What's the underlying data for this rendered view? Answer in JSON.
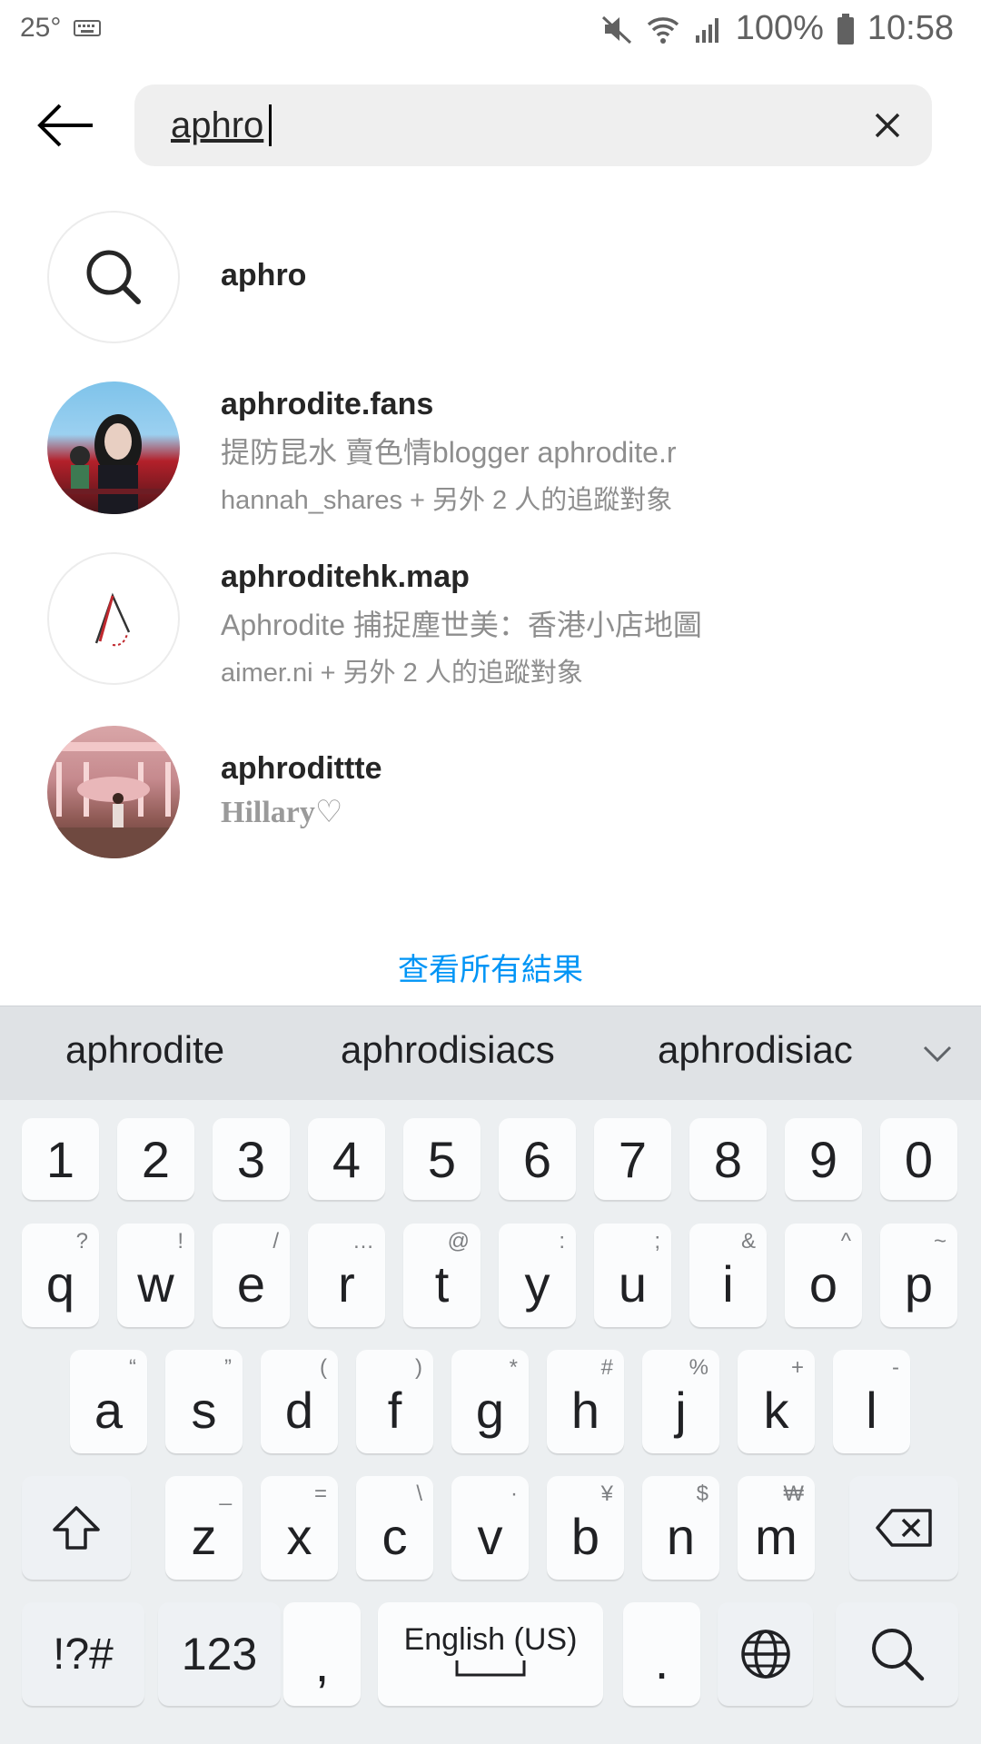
{
  "status_bar": {
    "temperature": "25°",
    "battery": "100%",
    "time": "10:58",
    "icons": [
      "keyboard-icon",
      "mute-icon",
      "wifi-icon",
      "signal-icon",
      "battery-icon"
    ]
  },
  "search": {
    "query": "aphro",
    "back_icon": "back-arrow-icon",
    "clear_icon": "close-icon"
  },
  "results": [
    {
      "type": "keyword",
      "title": "aphro",
      "icon": "search-icon"
    },
    {
      "type": "account",
      "username": "aphrodite.fans",
      "bio": "提防昆水 賣色情blogger aphrodite.r",
      "followed_by": "hannah_shares + 另外 2 人的追蹤對象"
    },
    {
      "type": "account",
      "username": "aphroditehk.map",
      "bio": "Aphrodite 捕捉塵世美：香港小店地圖",
      "followed_by": "aimer.ni + 另外 2 人的追蹤對象"
    },
    {
      "type": "account",
      "username": "aphrodittte",
      "bio": "Hillary♡"
    }
  ],
  "see_all": "查看所有結果",
  "keyboard": {
    "suggestions": [
      "aphrodite",
      "aphrodisiacs",
      "aphrodisiac"
    ],
    "numbers": [
      "1",
      "2",
      "3",
      "4",
      "5",
      "6",
      "7",
      "8",
      "9",
      "0"
    ],
    "row1": [
      [
        "q",
        "?"
      ],
      [
        "w",
        "!"
      ],
      [
        "e",
        "/"
      ],
      [
        "r",
        "…"
      ],
      [
        "t",
        "@"
      ],
      [
        "y",
        ":"
      ],
      [
        "u",
        ";"
      ],
      [
        "i",
        "&"
      ],
      [
        "o",
        "^"
      ],
      [
        "p",
        "~"
      ]
    ],
    "row2": [
      [
        "a",
        "“"
      ],
      [
        "s",
        "”"
      ],
      [
        "d",
        "("
      ],
      [
        "f",
        ")"
      ],
      [
        "g",
        "*"
      ],
      [
        "h",
        "#"
      ],
      [
        "j",
        "%"
      ],
      [
        "k",
        "+"
      ],
      [
        "l",
        "-"
      ]
    ],
    "row3": [
      [
        "z",
        "_"
      ],
      [
        "x",
        "="
      ],
      [
        "c",
        "\\"
      ],
      [
        "v",
        "·"
      ],
      [
        "b",
        "¥"
      ],
      [
        "n",
        "$"
      ],
      [
        "m",
        "₩"
      ]
    ],
    "sym_key": "!?#",
    "num_key": "123",
    "comma": ",",
    "space_label": "English (US)",
    "period": "."
  },
  "colors": {
    "link": "#0095f6",
    "secondary_text": "#8e8e8e",
    "search_bg": "#efefef",
    "keyboard_bg": "#eceff1"
  }
}
